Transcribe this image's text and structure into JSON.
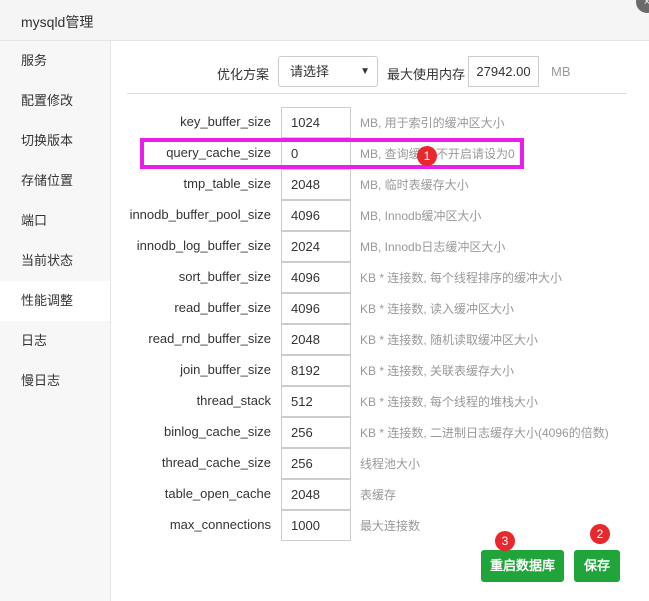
{
  "window": {
    "title": "mysqld管理",
    "close_icon": "×"
  },
  "sidebar": {
    "items": [
      {
        "label": "服务"
      },
      {
        "label": "配置修改"
      },
      {
        "label": "切换版本"
      },
      {
        "label": "存储位置"
      },
      {
        "label": "端口"
      },
      {
        "label": "当前状态"
      },
      {
        "label": "性能调整"
      },
      {
        "label": "日志"
      },
      {
        "label": "慢日志"
      }
    ],
    "active_index": 6
  },
  "optimize": {
    "label": "优化方案",
    "select_value": "请选择",
    "max_mem_label": "最大使用内存",
    "max_mem_value": "27942.00",
    "max_mem_unit": "MB"
  },
  "params": [
    {
      "name": "key_buffer_size",
      "value": "1024",
      "desc": "MB, 用于索引的缓冲区大小"
    },
    {
      "name": "query_cache_size",
      "value": "0",
      "desc": "MB, 查询缓存,不开启请设为0"
    },
    {
      "name": "tmp_table_size",
      "value": "2048",
      "desc": "MB, 临时表缓存大小"
    },
    {
      "name": "innodb_buffer_pool_size",
      "value": "4096",
      "desc": "MB, Innodb缓冲区大小"
    },
    {
      "name": "innodb_log_buffer_size",
      "value": "2024",
      "desc": "MB, Innodb日志缓冲区大小"
    },
    {
      "name": "sort_buffer_size",
      "value": "4096",
      "desc": "KB * 连接数, 每个线程排序的缓冲大小"
    },
    {
      "name": "read_buffer_size",
      "value": "4096",
      "desc": "KB * 连接数, 读入缓冲区大小"
    },
    {
      "name": "read_rnd_buffer_size",
      "value": "2048",
      "desc": "KB * 连接数, 随机读取缓冲区大小"
    },
    {
      "name": "join_buffer_size",
      "value": "8192",
      "desc": "KB * 连接数, 关联表缓存大小"
    },
    {
      "name": "thread_stack",
      "value": "512",
      "desc": "KB * 连接数, 每个线程的堆栈大小"
    },
    {
      "name": "binlog_cache_size",
      "value": "256",
      "desc": "KB * 连接数, 二进制日志缓存大小(4096的倍数)"
    },
    {
      "name": "thread_cache_size",
      "value": "256",
      "desc": "线程池大小"
    },
    {
      "name": "table_open_cache",
      "value": "2048",
      "desc": "表缓存"
    },
    {
      "name": "max_connections",
      "value": "1000",
      "desc": "最大连接数"
    }
  ],
  "buttons": {
    "restart_label": "重启数据库",
    "save_label": "保存"
  },
  "annotations": {
    "badge1": "1",
    "badge2": "2",
    "badge3": "3"
  },
  "colors": {
    "accent": "#20a53a",
    "highlight": "#e91ee9",
    "badge": "#e8282d"
  }
}
